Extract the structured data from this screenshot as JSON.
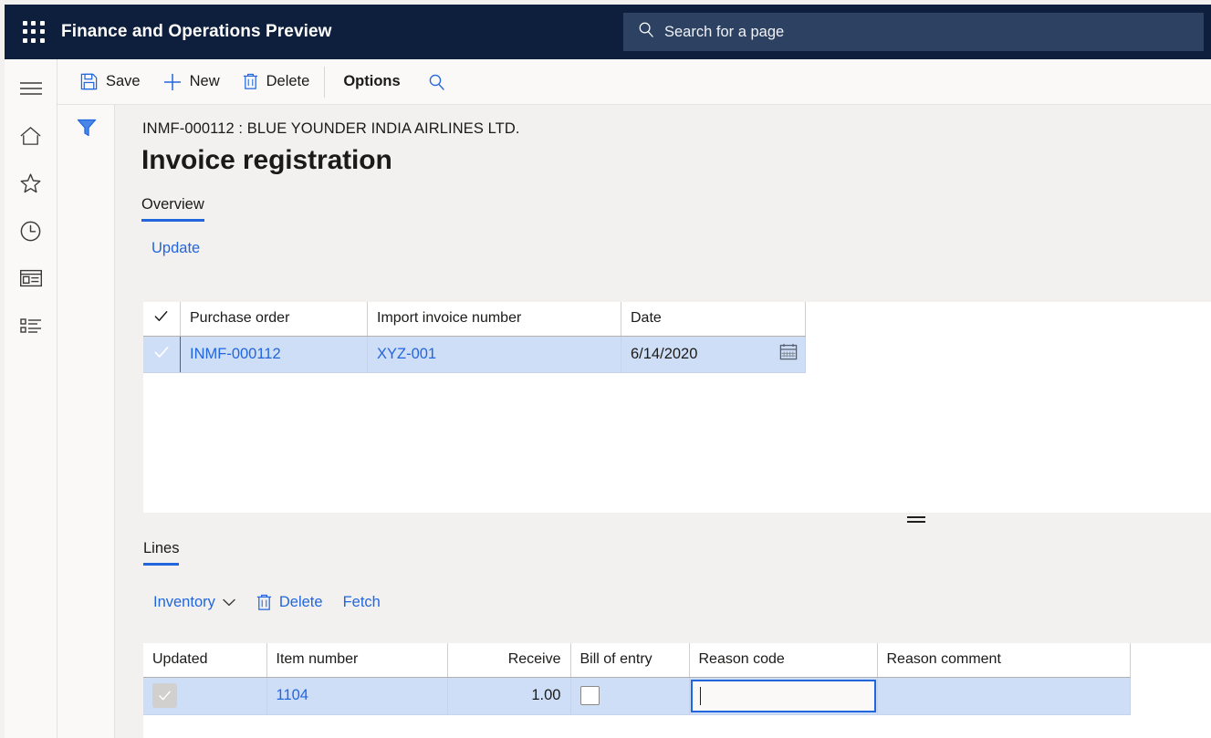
{
  "topbar": {
    "waffle_icon": "app-launcher-icon",
    "app_title": "Finance and Operations Preview",
    "search": {
      "placeholder": "Search for a page",
      "icon": "search-icon"
    }
  },
  "rail": {
    "items": [
      {
        "icon": "hamburger-menu-icon",
        "name": "navigation-menu"
      },
      {
        "icon": "home-icon",
        "name": "home"
      },
      {
        "icon": "star-icon",
        "name": "favorites"
      },
      {
        "icon": "clock-icon",
        "name": "recent"
      },
      {
        "icon": "workspace-icon",
        "name": "workspaces"
      },
      {
        "icon": "list-icon",
        "name": "modules"
      }
    ]
  },
  "commandbar": {
    "save_label": "Save",
    "new_label": "New",
    "delete_label": "Delete",
    "options_label": "Options",
    "search_icon": "search-icon"
  },
  "filterrail": {
    "filter_icon": "filter-funnel-icon"
  },
  "page": {
    "caption": "INMF-000112 : BLUE YOUNDER INDIA AIRLINES LTD.",
    "title": "Invoice registration",
    "tab": "Overview",
    "update_link": "Update"
  },
  "overview_grid": {
    "columns": [
      "Purchase order",
      "Import invoice number",
      "Date"
    ],
    "select_all_icon": "checkmark-icon",
    "rows": [
      {
        "selected": true,
        "purchase_order": "INMF-000112",
        "import_invoice_number": "XYZ-001",
        "date": "6/14/2020",
        "date_icon": "calendar-icon"
      }
    ]
  },
  "lines": {
    "tab": "Lines",
    "toolbar": {
      "inventory_label": "Inventory",
      "inventory_chevron_icon": "chevron-down-icon",
      "delete_label": "Delete",
      "delete_icon": "trash-icon",
      "fetch_label": "Fetch"
    },
    "columns": [
      "Updated",
      "Item number",
      "Receive",
      "Bill of entry",
      "Reason code",
      "Reason comment"
    ],
    "rows": [
      {
        "updated": true,
        "updated_disabled": true,
        "item_number": "1104",
        "receive": "1.00",
        "bill_of_entry": false,
        "reason_code": "",
        "reason_code_focused": true,
        "reason_comment": ""
      }
    ]
  },
  "splitter": {
    "name": "grid-splitter"
  },
  "colors": {
    "nav_bg": "#0d1f3c",
    "search_bg": "#2d4263",
    "accent": "#2266dd",
    "selected_row": "#cfdef7",
    "select_cell": "#2b62d9",
    "page_bg": "#f2f1f0"
  }
}
